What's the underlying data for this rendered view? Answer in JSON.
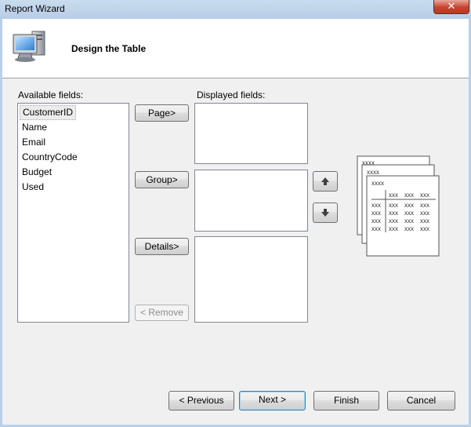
{
  "window": {
    "title": "Report Wizard",
    "close_symbol": "✕"
  },
  "header": {
    "title": "Design the Table",
    "icon": "computer-monitor-icon"
  },
  "available": {
    "label": "Available fields:",
    "items": [
      "CustomerID",
      "Name",
      "Email",
      "CountryCode",
      "Budget",
      "Used"
    ],
    "selected_index": 0
  },
  "displayed": {
    "label": "Displayed fields:"
  },
  "buttons": {
    "page": "Page>",
    "group": "Group>",
    "details": "Details>",
    "remove": "< Remove",
    "previous": "< Previous",
    "next": "Next >",
    "finish": "Finish",
    "cancel": "Cancel"
  },
  "preview": {
    "header_text": "xxxx",
    "cell_text": "xxx",
    "icon": "table-layout-preview-icon"
  },
  "colors": {
    "titlebar": "#c9dcef",
    "close_button": "#c5432b",
    "header_bg": "#ffffff",
    "dialog_bg": "#f0f0f0"
  }
}
